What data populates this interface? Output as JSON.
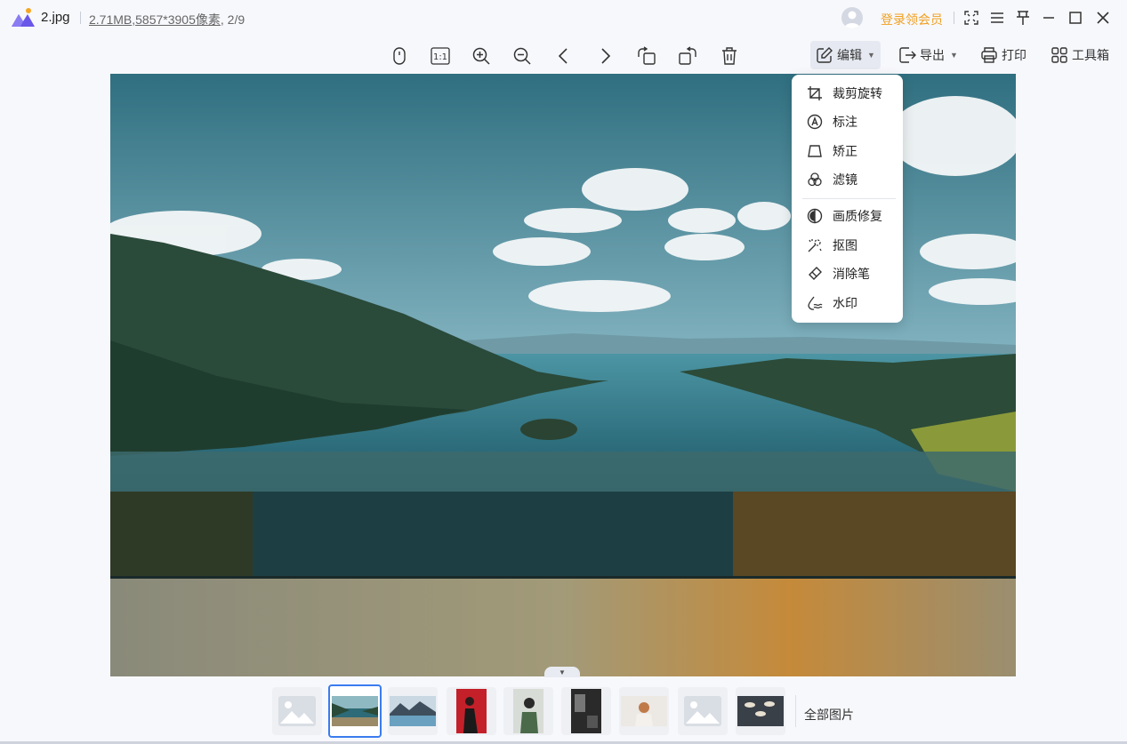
{
  "app": {
    "filename": "2.jpg",
    "file_size": "2.71MB",
    "resolution": ",5857*3905像素",
    "position": ", 2/9",
    "login_label": "登录领会员"
  },
  "toolbar": {
    "edit_label": "编辑",
    "export_label": "导出",
    "print_label": "打印",
    "toolbox_label": "工具箱",
    "ratio_label": "1:1"
  },
  "edit_menu": {
    "items": [
      {
        "label": "裁剪旋转",
        "icon": "crop-icon"
      },
      {
        "label": "标注",
        "icon": "annotate-icon"
      },
      {
        "label": "矫正",
        "icon": "correct-icon"
      },
      {
        "label": "滤镜",
        "icon": "filter-icon"
      },
      {
        "label": "画质修复",
        "icon": "quality-icon"
      },
      {
        "label": "抠图",
        "icon": "cutout-icon"
      },
      {
        "label": "消除笔",
        "icon": "eraser-icon"
      },
      {
        "label": "水印",
        "icon": "watermark-icon"
      }
    ]
  },
  "thumbnails": {
    "all_label": "全部图片",
    "count": 9,
    "selected_index": 1
  },
  "colors": {
    "accent": "#3a7cf0",
    "vip": "#f0a020",
    "background": "#f7f8fc"
  }
}
